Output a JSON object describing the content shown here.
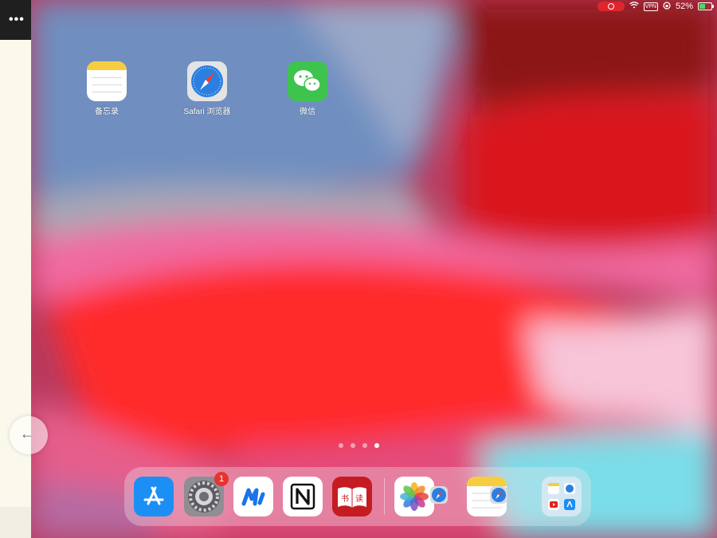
{
  "status_bar": {
    "vpn": "VPN",
    "battery": "52%"
  },
  "home_apps": [
    {
      "label": "备忘录"
    },
    {
      "label": "Safari 浏览器"
    },
    {
      "label": "微信"
    }
  ],
  "page_indicator": {
    "total": 4,
    "current": 4
  },
  "dock": {
    "settings_badge": "1",
    "books_glyph_1": "书",
    "books_glyph_2": "读"
  },
  "colors": {
    "wallpaper_red": "#ff2a2a",
    "wallpaper_blue": "#6f8fc0",
    "wallpaper_pink": "#f06aa0",
    "wallpaper_cyan": "#7adde8",
    "badge": "#e8332e"
  }
}
